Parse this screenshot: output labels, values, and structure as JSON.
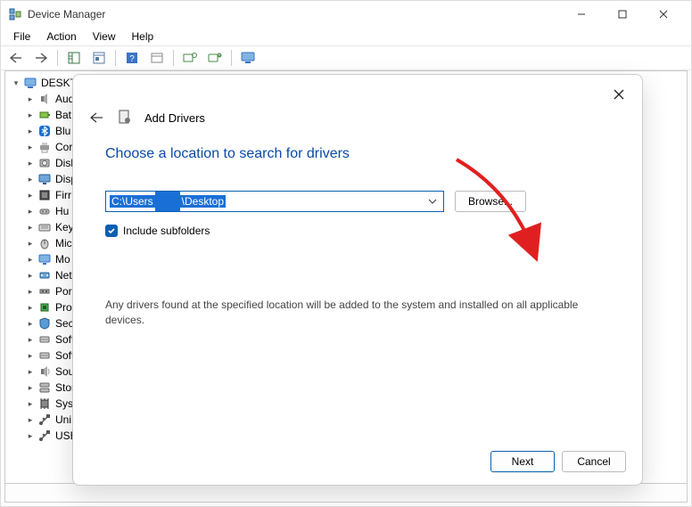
{
  "window": {
    "title": "Device Manager"
  },
  "menu": {
    "items": [
      "File",
      "Action",
      "View",
      "Help"
    ]
  },
  "tree": {
    "root": "DESKTO",
    "children": [
      {
        "label": "Aud",
        "icon": "speaker"
      },
      {
        "label": "Bat",
        "icon": "battery"
      },
      {
        "label": "Blu",
        "icon": "bluetooth"
      },
      {
        "label": "Cor",
        "icon": "printer"
      },
      {
        "label": "Disl",
        "icon": "disk"
      },
      {
        "label": "Disp",
        "icon": "display"
      },
      {
        "label": "Firr",
        "icon": "firmware"
      },
      {
        "label": "Hu",
        "icon": "hid"
      },
      {
        "label": "Key",
        "icon": "keyboard"
      },
      {
        "label": "Mic",
        "icon": "mouse"
      },
      {
        "label": "Mo",
        "icon": "monitor"
      },
      {
        "label": "Net",
        "icon": "network"
      },
      {
        "label": "Por",
        "icon": "port"
      },
      {
        "label": "Pro",
        "icon": "cpu"
      },
      {
        "label": "Sec",
        "icon": "security"
      },
      {
        "label": "Soft",
        "icon": "component"
      },
      {
        "label": "Soft",
        "icon": "component"
      },
      {
        "label": "Sou",
        "icon": "sound"
      },
      {
        "label": "Stor",
        "icon": "storage"
      },
      {
        "label": "Syst",
        "icon": "chip"
      },
      {
        "label": "Uni",
        "icon": "usb"
      },
      {
        "label": "USE",
        "icon": "usb"
      }
    ]
  },
  "dialog": {
    "title": "Add Drivers",
    "heading": "Choose a location to search for drivers",
    "path_prefix": "C:\\Users",
    "path_suffix": "\\Desktop",
    "browse_label": "Browse...",
    "checkbox_label": "Include subfolders",
    "checkbox_checked": true,
    "description": "Any drivers found at the specified location will be added to the system and installed on all applicable devices.",
    "next_label": "Next",
    "cancel_label": "Cancel"
  }
}
